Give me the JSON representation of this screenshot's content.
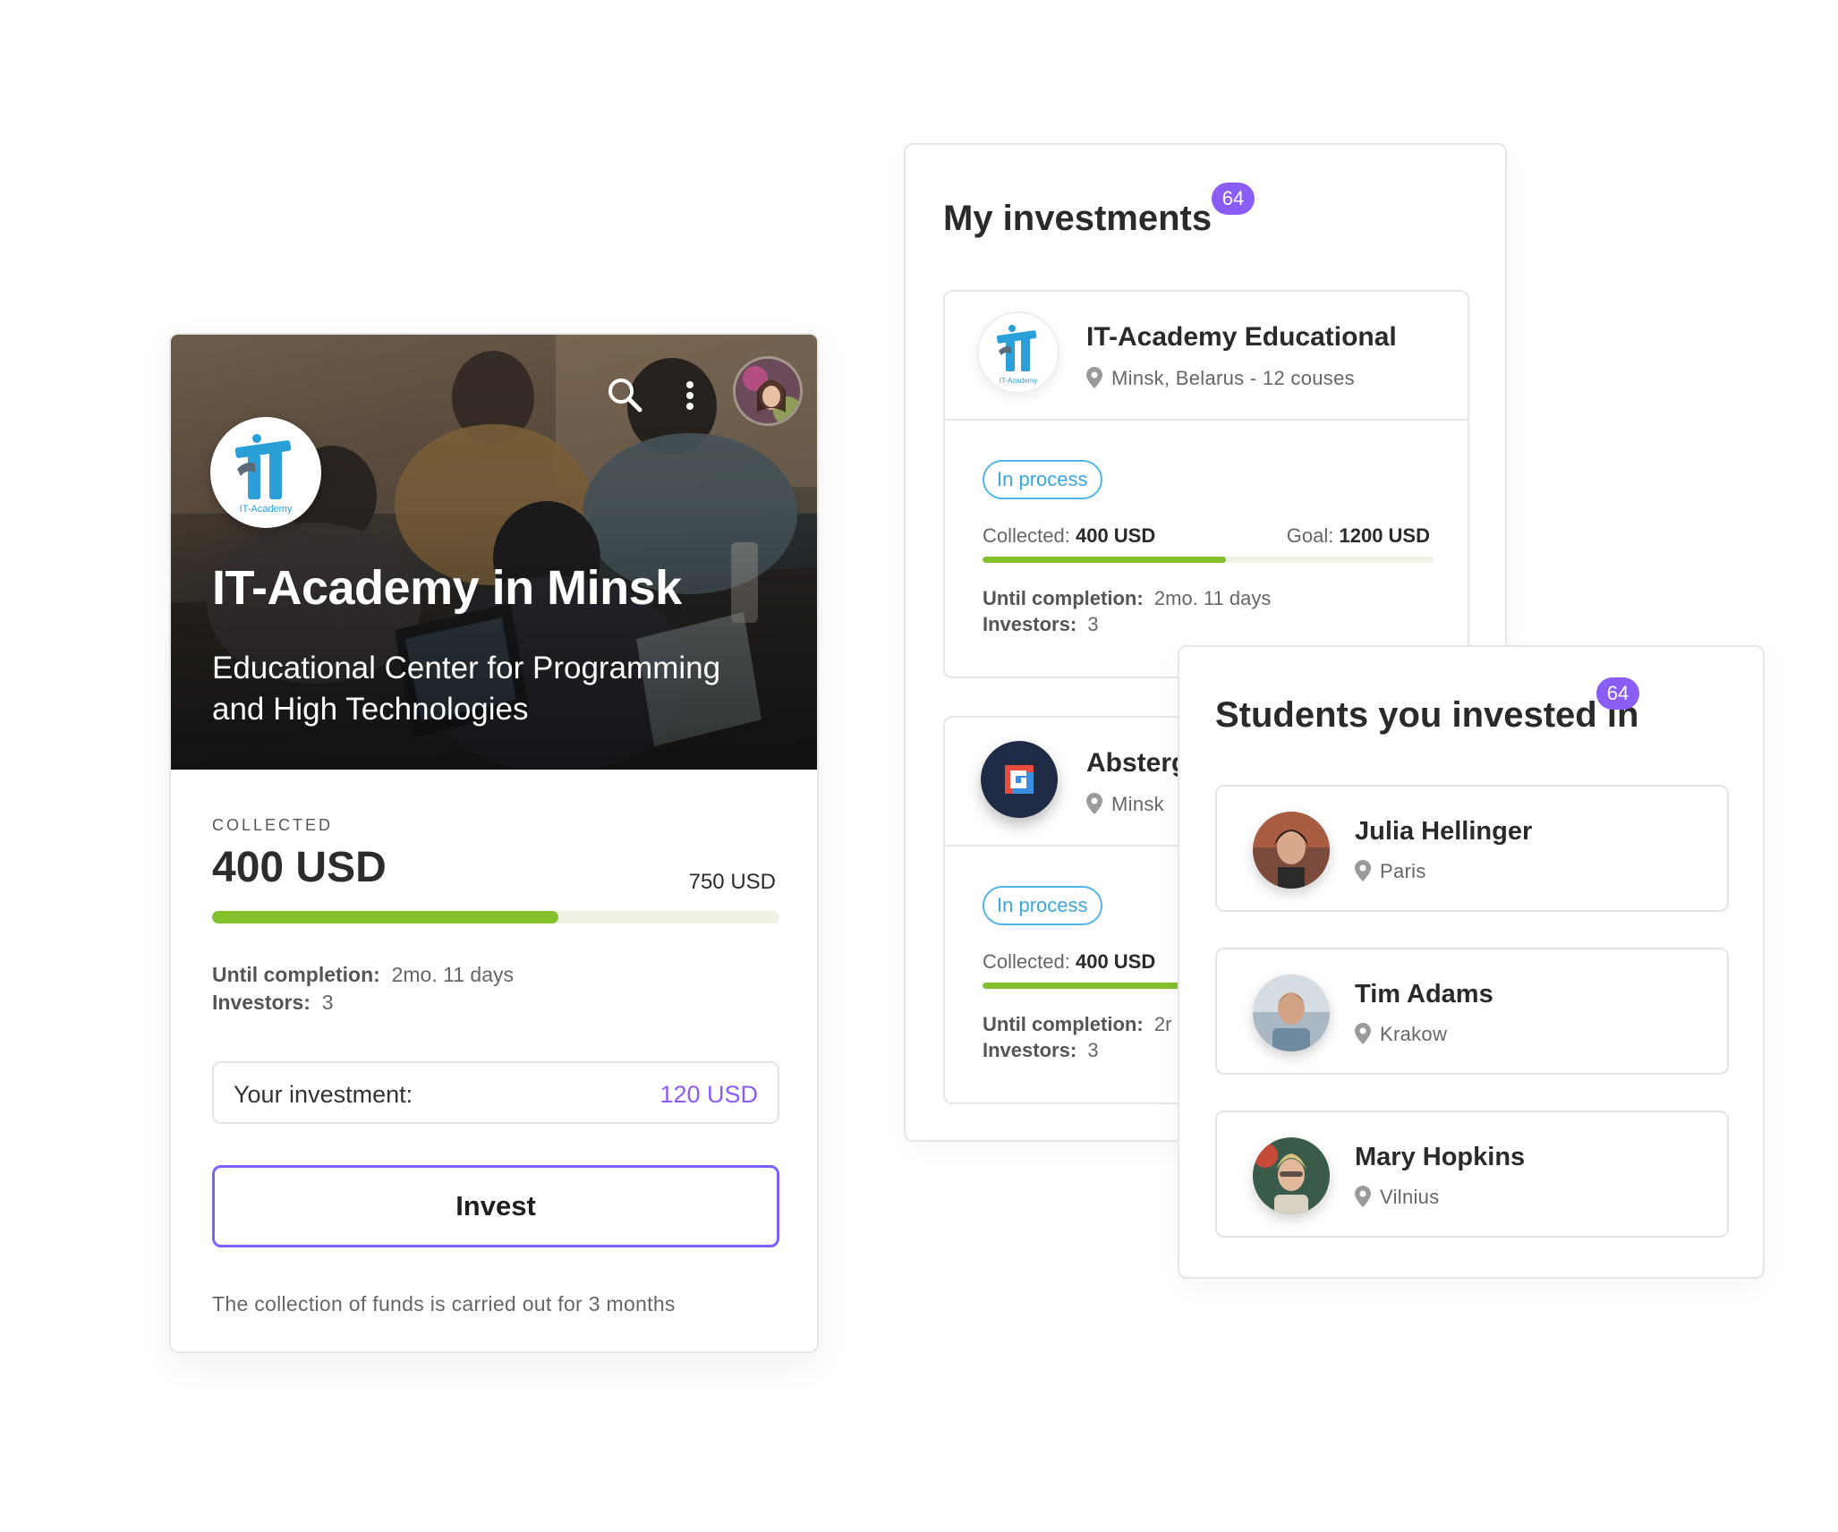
{
  "course_card": {
    "title": "IT-Academy in Minsk",
    "subtitle": "Educational Center for Programming and High Technologies",
    "logo_text": "IT-Academy",
    "collected_caption": "COLLECTED",
    "collected_amount": "400 USD",
    "goal_amount": "750 USD",
    "progress_fraction": 0.61,
    "until_completion_label": "Until completion:",
    "until_completion_value": "2mo. 11 days",
    "investors_label": "Investors:",
    "investors_value": "3",
    "your_investment_label": "Your investment:",
    "your_investment_value": "120 USD",
    "invest_button": "Invest",
    "footnote": "The collection of funds is carried out for 3 months",
    "icons": [
      "search-icon",
      "more-vertical-icon",
      "user-avatar"
    ]
  },
  "investments_panel": {
    "title": "My investments",
    "badge": "64",
    "items": [
      {
        "name": "IT-Academy Educational",
        "location": "Minsk, Belarus - 12 couses",
        "logo_text": "IT-Academy",
        "status": "In process",
        "collected_label": "Collected:",
        "collected_value": "400 USD",
        "goal_label": "Goal:",
        "goal_value": "1200 USD",
        "progress_fraction": 0.54,
        "until_completion_label": "Until completion:",
        "until_completion_value": "2mo. 11 days",
        "investors_label": "Investors:",
        "investors_value": "3"
      },
      {
        "name": "Absterg",
        "location": "Minsk",
        "status": "In process",
        "collected_label": "Collected:",
        "collected_value": "400 USD",
        "until_completion_label": "Until completion:",
        "until_completion_value": "2r",
        "investors_label": "Investors:",
        "investors_value": "3"
      }
    ]
  },
  "students_panel": {
    "title": "Students you invested in",
    "badge": "64",
    "students": [
      {
        "name": "Julia Hellinger",
        "city": "Paris"
      },
      {
        "name": "Tim Adams",
        "city": "Krakow"
      },
      {
        "name": "Mary Hopkins",
        "city": "Vilnius"
      }
    ]
  },
  "colors": {
    "accent_purple": "#8b5cf6",
    "button_border": "#7b61ff",
    "progress_green": "#82c02c",
    "progress_track": "#eef1e3",
    "status_blue": "#3aa6dc"
  }
}
